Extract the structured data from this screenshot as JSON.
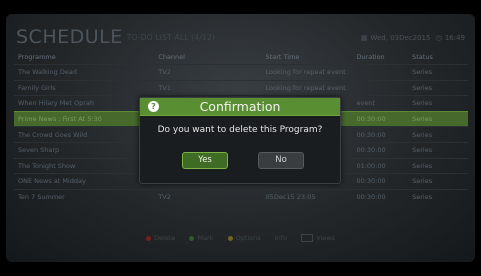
{
  "header": {
    "title": "SCHEDULE",
    "subtitle": "TO-DO LIST ALL (4/12)",
    "date": "Wed, 03Dec2015",
    "time": "16:49"
  },
  "columns": [
    "Programme",
    "Channel",
    "Start Time",
    "Duration",
    "Status"
  ],
  "rows": [
    {
      "programme": "The Walking Dead",
      "channel": "TV2",
      "start": "Looking for repeat event",
      "duration": "",
      "status": "Series"
    },
    {
      "programme": "Family Girls",
      "channel": "TV1",
      "start": "Looking for repeat event",
      "duration": "",
      "status": "Series"
    },
    {
      "programme": "When Hilary Met Oprah",
      "channel": "",
      "start": "",
      "duration": "event",
      "status": "Series"
    },
    {
      "programme": "Prime News : First At 5:30",
      "channel": "",
      "start": "",
      "duration": "00:30:00",
      "status": "Series"
    },
    {
      "programme": "The Crowd Goes Wild",
      "channel": "",
      "start": "",
      "duration": "00:30:00",
      "status": "Series"
    },
    {
      "programme": "Seven Sharp",
      "channel": "",
      "start": "",
      "duration": "00:30:00",
      "status": "Series"
    },
    {
      "programme": "The Tonight Show",
      "channel": "",
      "start": "",
      "duration": "01:00:00",
      "status": "Series"
    },
    {
      "programme": "ONE News at Midday",
      "channel": "",
      "start": "",
      "duration": "00:30:00",
      "status": "Series"
    },
    {
      "programme": "Ten 7 Summer",
      "channel": "TV2",
      "start": "05Dec15 23:05",
      "duration": "00:30:00",
      "status": "Series"
    }
  ],
  "footer": {
    "delete": "Delete",
    "mark": "Mark",
    "options": "Options",
    "info": "Info",
    "views": "Views"
  },
  "dialog": {
    "title": "Confirmation",
    "message": "Do you want to delete this Program?",
    "yes": "Yes",
    "no": "No"
  }
}
